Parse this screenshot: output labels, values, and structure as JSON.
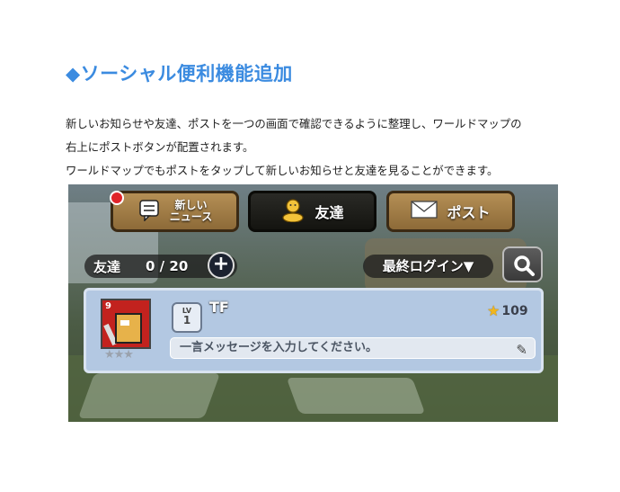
{
  "article": {
    "heading": "◆ソーシャル便利機能追加",
    "paragraphs": [
      "新しいお知らせや友達、ポストを一つの画面で確認できるように整理し、ワールドマップの",
      "右上にポストボタンが配置されます。",
      "ワールドマップでもポストをタップして新しいお知らせと友達を見ることができます。"
    ]
  },
  "game_ui": {
    "tabs": {
      "news_line1": "新しい",
      "news_line2": "ニュース",
      "friends": "友達",
      "post": "ポスト"
    },
    "friend_count": {
      "label": "友達",
      "value": "0 / 20"
    },
    "add_button": "+",
    "sort": "最終ログイン▼",
    "friend_card": {
      "avatar_number": "9",
      "stars": "★★★",
      "level_label": "LV",
      "level": "1",
      "name": "TF",
      "score": "109",
      "message_placeholder": "一言メッセージを入力してください。"
    }
  },
  "colors": {
    "heading": "#3b8be0",
    "tab_gold": "#a37d46",
    "tab_active": "#1e1e1a",
    "card": "#b3c8e2",
    "notification": "#e0242a",
    "star": "#f2b61c"
  },
  "icons": [
    "news-icon",
    "friends-icon",
    "mail-icon",
    "plus-icon",
    "search-icon",
    "star-icon",
    "pencil-icon"
  ]
}
